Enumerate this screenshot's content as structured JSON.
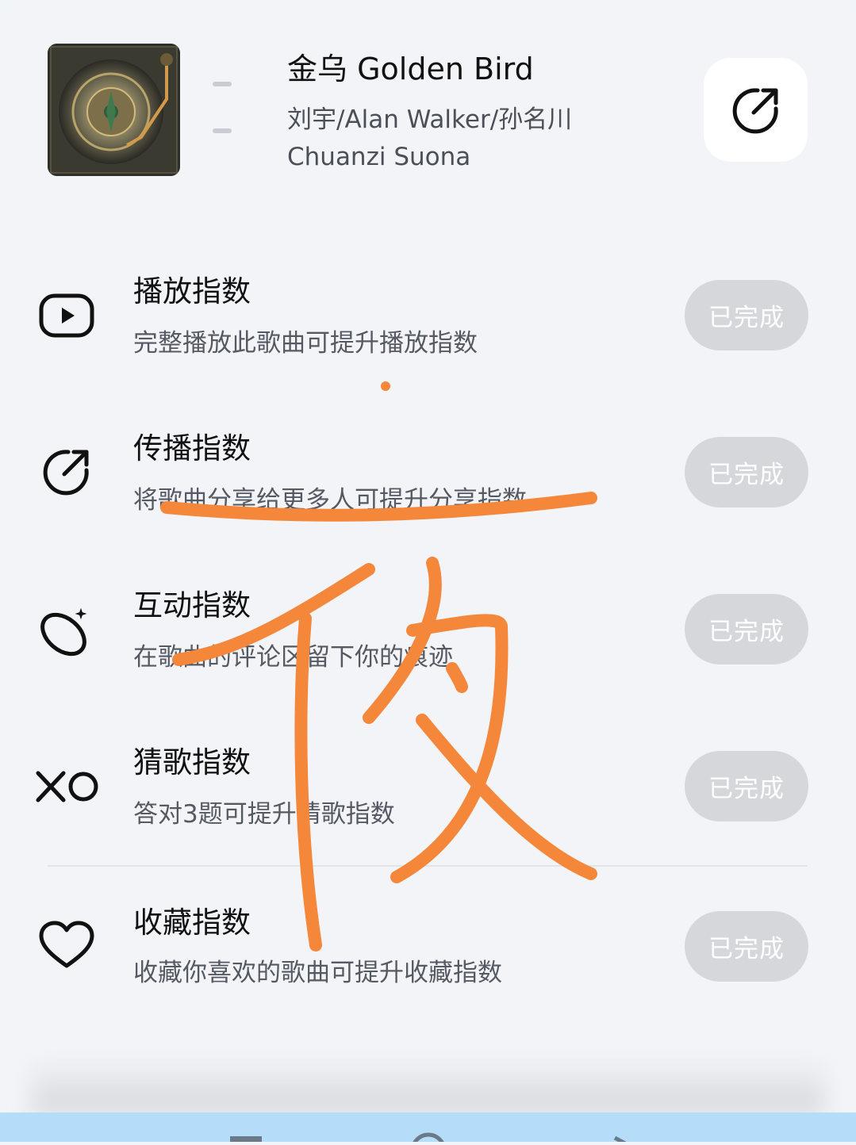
{
  "song": {
    "title": "金乌 Golden Bird",
    "artists": "刘宇/Alan Walker/孙名川 Chuanzi Suona"
  },
  "tasks": [
    {
      "icon": "play-icon",
      "title": "播放指数",
      "desc": "完整播放此歌曲可提升播放指数",
      "status": "已完成"
    },
    {
      "icon": "share-icon",
      "title": "传播指数",
      "desc": "将歌曲分享给更多人可提升分享指数",
      "status": "已完成"
    },
    {
      "icon": "comment-sparkle-icon",
      "title": "互动指数",
      "desc": "在歌曲的评论区留下你的痕迹",
      "status": "已完成"
    },
    {
      "icon": "xo-icon",
      "title": "猜歌指数",
      "desc": "答对3题可提升猜歌指数",
      "status": "已完成"
    },
    {
      "icon": "heart-icon",
      "title": "收藏指数",
      "desc": "收藏你喜欢的歌曲可提升收藏指数",
      "status": "已完成"
    }
  ],
  "colors": {
    "background": "#f2f4f8",
    "done_button": "#d5d7db",
    "annotation": "#f5873a",
    "navbar": "#b5dcf9"
  }
}
